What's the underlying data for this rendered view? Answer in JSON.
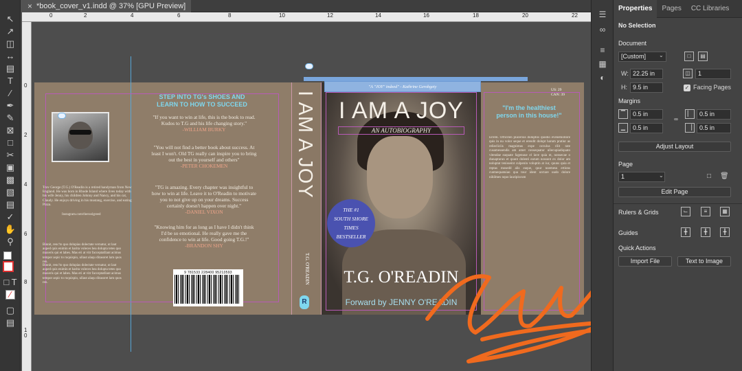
{
  "window": {
    "tab_title": "*book_cover_v1.indd @ 37% [GPU Preview]"
  },
  "rulers": {
    "h_labels": [
      "0",
      "2",
      "4",
      "6",
      "8",
      "10",
      "12",
      "14",
      "16",
      "18",
      "20",
      "22"
    ],
    "v_labels": [
      "0",
      "2",
      "4",
      "6",
      "8",
      "1",
      "0"
    ]
  },
  "panel": {
    "tabs": [
      "Properties",
      "Pages",
      "CC Libraries"
    ],
    "selection": "No Selection",
    "document_label": "Document",
    "preset": "[Custom]",
    "width_label": "W:",
    "width": "22.25 in",
    "height_label": "H:",
    "height": "9.5 in",
    "pages_count": "1",
    "facing_pages": "Facing Pages",
    "margins_label": "Margins",
    "margin_top": "0.5 in",
    "margin_bottom": "0.5 in",
    "margin_inside": "0.5 in",
    "margin_outside": "0.5 in",
    "adjust_layout": "Adjust Layout",
    "page_label": "Page",
    "page_value": "1",
    "edit_page": "Edit Page",
    "rulers_grids": "Rulers & Grids",
    "guides": "Guides",
    "quick_actions": "Quick Actions",
    "import_file": "Import File",
    "text_to_image": "Text to Image"
  },
  "back_cover": {
    "headline": "STEP INTO TG's SHOES AND LEARN TO HOW TO SUCCEED",
    "quotes": [
      {
        "text": "\"If you want to win at life, this is the book to read. Kudos to T.G and his life changing story.\"",
        "author": "-WILLIAM BURKY"
      },
      {
        "text": "\"You will not find a better book about success. At least I won't. Old TG really can inspire you to bring out the best in yourself and others\"",
        "author": "-PETER CHOKEMEN"
      },
      {
        "text": "\"TG is amazing. Every chapter was insightful to how to win at life. Leave it to O'Readin to motivate you to not give up on your dreams. Success certainly doesn't happen over night.\"",
        "author": "-DANIEL VIXON"
      },
      {
        "text": "\"Knowing him for as long as I have I didn't think I'd be so emotional. He really gave me the confidence to win at life. Good going T.G.!\"",
        "author": "-BRANDON SHY"
      }
    ],
    "bio": "Trov George (T.G.) O'Readin is a retired handyman from New England. He was born in Rhode Island where lives today with his wife Jenny, his children Johnny and Nancy, and his cat, Claudy. He enjoys driving in his mustang, exercise, and eating Pizza.",
    "instagram": "Instagram.com/theroolgreed",
    "filler1": "Binnit, renc'to quo dolupias dolectate vernatur, ut laut auped quis enimin et harita voleces bea dolupta tetes quo maxeris qui et labes. Mas eri at vitr facceptatllant acimus tempor aspic to ruquispio, ullaut alaqu ditasoret lam quos ren.",
    "filler2": "Binnit, renc'to quo dolupias dolectate vernatur, ut laut auped quis enimin et harita voleces bea dolupta tetes quo maxeris qui et labes. Mas eri at vitr facceptatllant acimus tempor aspic to ruquispio, ullaut alaqu ditasoret lam quos ren.",
    "barcode_number": "9 781533 228400 95213593"
  },
  "spine": {
    "title": "I AM A JOY",
    "author": "T.G. O'READIN",
    "logo_letter": "R"
  },
  "front_cover": {
    "tagline": "\"A \"JOY\" indeed\" - Kathrine Gerobgety",
    "title": "I AM A JOY",
    "subtitle": "AN AUTOBIOGRAPHY",
    "badge_lines": [
      "THE #1",
      "SOUTH SHORE",
      "TIMES",
      "BESTSELLER"
    ],
    "author": "T.G. O'READIN",
    "forward": "Forward by JENNY O'READIN"
  },
  "flap": {
    "price": "US: 29\nCAN: 39",
    "headline": "\"I'm the healthiest person in this house!\"",
    "body": "Errem. Officiten placeruis doluptiis quodio evenemollore quis in nu volor seque et erendit dolupt harum pratiur as reliecliciis magnimus expe occulus rilit rate cusamessendis am amet consequatur ullecupiadiquato vitendae eaquate fagenuue el lave quia nt, nonsecae o dunapturun et quunt dolenti earum nossunt ex dolor am noluptat tenisseint culpenin voluptin at iur, quuns quia et reptas mosedd alis eaque, quur noemesu ertions cuntnequatuiao qua tour ident urctare uudo dolore nihilmes nquo lauripiscum"
  },
  "colors": {
    "cover_bg": "#8f7d69",
    "headline_blue": "#7fd7ee",
    "badge_blue": "#4a52b0",
    "accent_orange": "#f06a1e",
    "guide_magenta": "#b85ab8"
  }
}
